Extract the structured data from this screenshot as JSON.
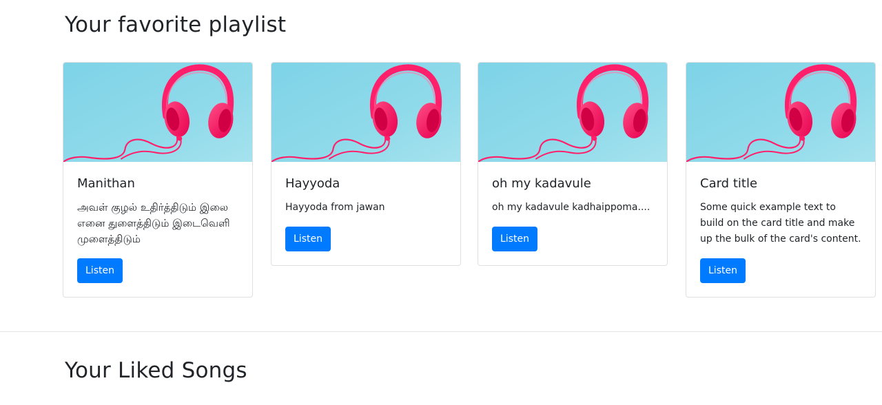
{
  "playlist_section": {
    "title": "Your favorite playlist",
    "cards": [
      {
        "title": "Manithan",
        "text": "அவள் குழல் உதிர்த்திடும் இலை எனை துளைத்திடும் இடைவெளி முளைத்திடும்",
        "button": "Listen"
      },
      {
        "title": "Hayyoda",
        "text": "Hayyoda from jawan",
        "button": "Listen"
      },
      {
        "title": "oh my kadavule",
        "text": "oh my kadavule kadhaippoma....",
        "button": "Listen"
      },
      {
        "title": "Card title",
        "text": "Some quick example text to build on the card title and make up the bulk of the card's content.",
        "button": "Listen"
      }
    ]
  },
  "liked_section": {
    "title": "Your Liked Songs"
  },
  "colors": {
    "button_bg": "#007bff",
    "image_bg": "#7fd3e6",
    "headphones": "#ff1f6b"
  }
}
